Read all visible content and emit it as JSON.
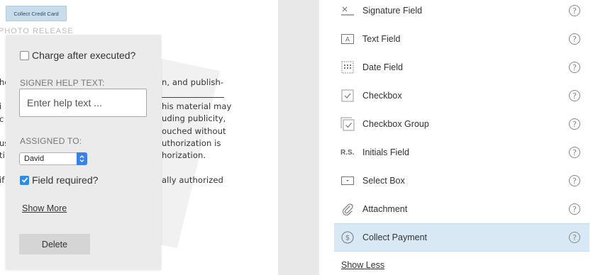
{
  "document": {
    "collect_tag": "Collect Credit Card",
    "heading": "PHOTO RELEASE",
    "lines": [
      {
        "text": "n, and publish-"
      },
      {
        "text": "his material may"
      },
      {
        "text": "uding publicity,"
      },
      {
        "text": "ouched without"
      },
      {
        "text": "uthorization is"
      },
      {
        "text": "horization."
      },
      {
        "text": "ally authorized"
      }
    ],
    "left_fragments": [
      "he",
      "i",
      "c",
      "us",
      "ti",
      "if"
    ]
  },
  "popup": {
    "charge_label": "Charge after executed?",
    "charge_checked": false,
    "signer_help_label": "SIGNER HELP TEXT:",
    "help_placeholder": "Enter help text ...",
    "assigned_label": "ASSIGNED TO:",
    "assigned_value": "David",
    "required_label": "Field required?",
    "required_checked": true,
    "show_more": "Show More",
    "delete": "Delete"
  },
  "palette": {
    "fields": [
      {
        "label": "Signature Field",
        "icon": "signature-icon"
      },
      {
        "label": "Text Field",
        "icon": "text-field-icon"
      },
      {
        "label": "Date Field",
        "icon": "calendar-icon"
      },
      {
        "label": "Checkbox",
        "icon": "checkbox-icon"
      },
      {
        "label": "Checkbox Group",
        "icon": "checkbox-group-icon"
      },
      {
        "label": "Initials Field",
        "icon": "initials-icon",
        "icon_text": "R.S."
      },
      {
        "label": "Select Box",
        "icon": "select-box-icon"
      },
      {
        "label": "Attachment",
        "icon": "paperclip-icon"
      },
      {
        "label": "Collect Payment",
        "icon": "dollar-icon",
        "active": true
      }
    ],
    "help_glyph": "?",
    "show_less": "Show Less"
  },
  "colors": {
    "accent": "#2f8be6",
    "active_row": "#d8e9f5",
    "tag_bg": "#c9dcea"
  }
}
